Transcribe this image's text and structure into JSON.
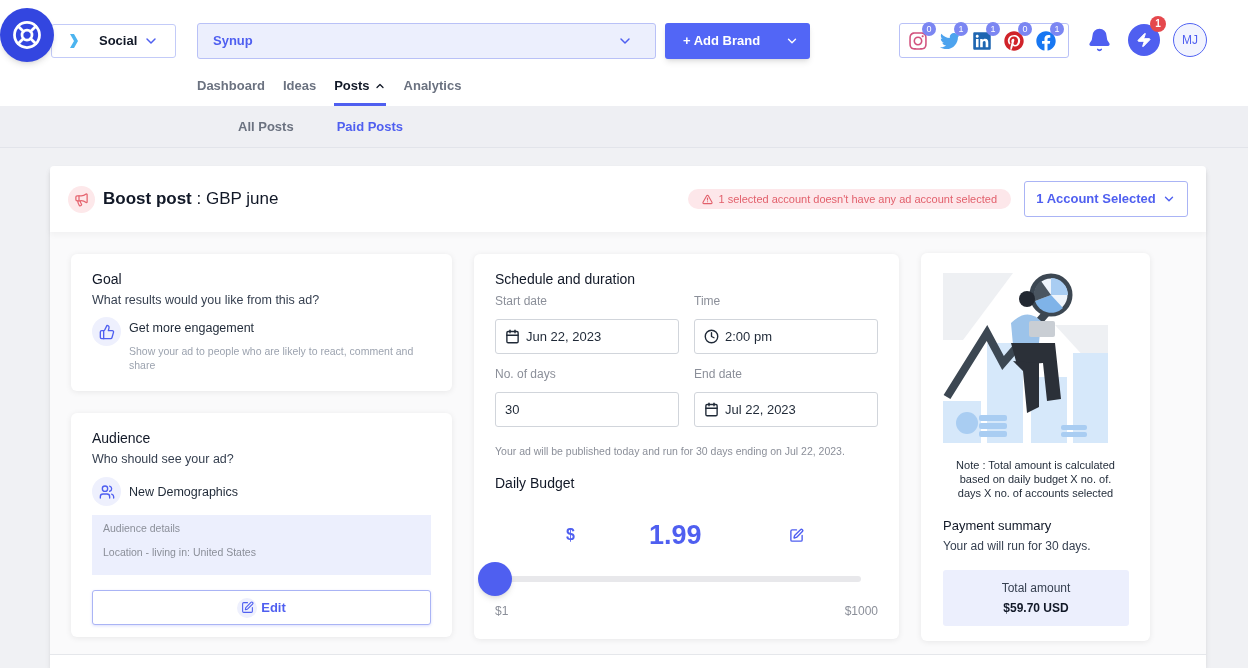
{
  "top_bar": {
    "workspace_dropdown": {
      "label": "Social"
    },
    "brand_dropdown": {
      "value": "Synup"
    },
    "add_brand_button": "+ Add Brand",
    "social_accounts": [
      {
        "kind": "instagram",
        "count": "0"
      },
      {
        "kind": "twitter",
        "count": "1"
      },
      {
        "kind": "linkedin",
        "count": "1"
      },
      {
        "kind": "pinterest",
        "count": "0"
      },
      {
        "kind": "facebook",
        "count": "1"
      }
    ],
    "alerts": {
      "badge": "1"
    },
    "avatar": {
      "initials": "MJ"
    }
  },
  "nav_tabs": [
    {
      "label": "Dashboard",
      "selected": false
    },
    {
      "label": "Ideas",
      "selected": false
    },
    {
      "label": "Posts",
      "selected": true,
      "expanded": true
    },
    {
      "label": "Analytics",
      "selected": false
    }
  ],
  "sub_tabs": [
    {
      "label": "All Posts",
      "selected": false
    },
    {
      "label": "Paid Posts",
      "selected": true
    }
  ],
  "boost_post": {
    "title": "**Boost post** : GBP june",
    "warning": "1 selected account doesn't have any ad account selected",
    "account_button": "1 Account Selected"
  },
  "goal": {
    "title": "Goal",
    "question": "What results would you like from this ad?",
    "option": {
      "label": "Get more engagement",
      "description": "Show your ad to people who are likely to react, comment and share"
    }
  },
  "audience": {
    "title": "Audience",
    "question": "Who should see your ad?",
    "option": {
      "label": "New Demographics"
    },
    "details": [
      "Audience details",
      "Location - living in: United States"
    ],
    "edit_button": "Edit"
  },
  "schedule": {
    "title": "Schedule and duration",
    "fields": [
      {
        "kind": "date",
        "label": "Start date",
        "value": "Jun 22, 2023"
      },
      {
        "kind": "time",
        "label": "Time",
        "value": "2:00 pm"
      },
      {
        "kind": "number",
        "label": "No. of days",
        "value": "30"
      },
      {
        "kind": "date",
        "label": "End date",
        "value": "Jul 22, 2023"
      }
    ],
    "note": "Your ad will be published today and run for 30 days ending on Jul 22, 2023."
  },
  "daily_budget": {
    "title": "Daily Budget",
    "currency": "$",
    "amount": "1.99",
    "level": 0.001,
    "min_label": "$1",
    "max_label": "$1000"
  },
  "summary": {
    "note": "Note : Total amount is calculated based on daily budget X no. of. days X no. of accounts selected",
    "title": "Payment summary",
    "text": "Your ad will run for 30 days.",
    "total_label": "Total amount",
    "total_value": "$59.70 USD"
  }
}
